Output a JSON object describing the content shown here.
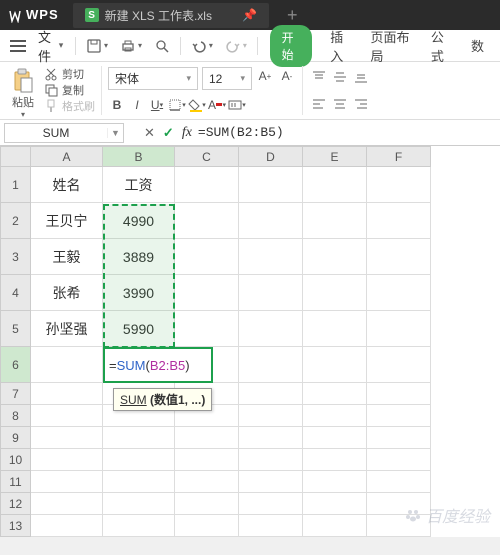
{
  "titlebar": {
    "app_logo": "WPS",
    "tab_title": "新建 XLS 工作表.xls",
    "tab_icon_char": "S"
  },
  "menubar": {
    "file": "文件",
    "start": "开始",
    "insert": "插入",
    "pagelayout": "页面布局",
    "formulas": "公式",
    "data": "数"
  },
  "ribbon": {
    "paste": "粘贴",
    "cut": "剪切",
    "copy": "复制",
    "format_painter": "格式刷",
    "font_name": "宋体",
    "font_size": "12"
  },
  "namebox": {
    "value": "SUM"
  },
  "formula_bar": {
    "value": "=SUM(B2:B5)"
  },
  "columns": [
    "A",
    "B",
    "C",
    "D",
    "E",
    "F"
  ],
  "rows": [
    {
      "n": "1",
      "a": "姓名",
      "b": "工资",
      "tall": true
    },
    {
      "n": "2",
      "a": "王贝宁",
      "b": "4990",
      "tall": true
    },
    {
      "n": "3",
      "a": "王毅",
      "b": "3889",
      "tall": true
    },
    {
      "n": "4",
      "a": "张希",
      "b": "3990",
      "tall": true
    },
    {
      "n": "5",
      "a": "孙坚强",
      "b": "5990",
      "tall": true
    },
    {
      "n": "6",
      "a": "",
      "b": "",
      "tall": true
    },
    {
      "n": "7",
      "a": "",
      "b": ""
    },
    {
      "n": "8",
      "a": "",
      "b": ""
    },
    {
      "n": "9",
      "a": "",
      "b": ""
    },
    {
      "n": "10",
      "a": "",
      "b": ""
    },
    {
      "n": "11",
      "a": "",
      "b": ""
    },
    {
      "n": "12",
      "a": "",
      "b": ""
    },
    {
      "n": "13",
      "a": "",
      "b": ""
    }
  ],
  "active_cell": {
    "prefix": "=",
    "fn": "SUM",
    "open": "(",
    "range": "B2:B5",
    "close": ")"
  },
  "tooltip": {
    "fn": "SUM",
    "args": " (数值1, ...)"
  },
  "watermark": "百度经验"
}
